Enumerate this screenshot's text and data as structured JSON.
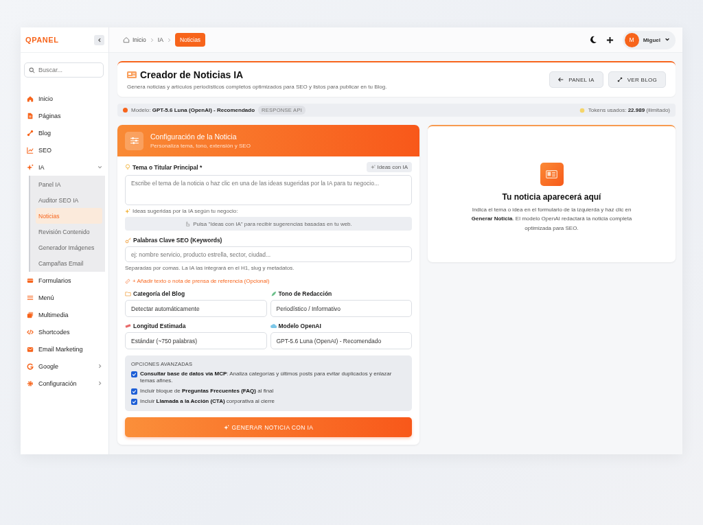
{
  "sidebar": {
    "logo": "QPANEL",
    "search": {
      "placeholder": "Buscar..."
    },
    "items": [
      {
        "label": "Inicio"
      },
      {
        "label": "Páginas"
      },
      {
        "label": "Blog"
      },
      {
        "label": "SEO"
      },
      {
        "label": "IA",
        "expanded": true,
        "children": [
          {
            "label": "Panel IA",
            "selected": false
          },
          {
            "label": "Auditor SEO IA",
            "selected": false
          },
          {
            "label": "Noticias",
            "selected": true
          },
          {
            "label": "Revisión Contenido",
            "selected": false
          },
          {
            "label": "Generador Imágenes",
            "selected": false
          },
          {
            "label": "Campañas Email",
            "selected": false
          }
        ]
      },
      {
        "label": "Formularios"
      },
      {
        "label": "Menú"
      },
      {
        "label": "Multimedia"
      },
      {
        "label": "Shortcodes"
      },
      {
        "label": "Email Marketing"
      },
      {
        "label": "Google",
        "expanded": false
      },
      {
        "label": "Configuración",
        "expanded": false
      }
    ]
  },
  "topbar": {
    "breadcrumb": [
      {
        "label": "Inicio",
        "current": false
      },
      {
        "label": "IA",
        "current": false
      },
      {
        "label": "Noticias",
        "current": true
      }
    ],
    "user": {
      "initial": "M",
      "name": "Miguel"
    }
  },
  "header": {
    "title": "Creador de Noticias IA",
    "subtitle": "Genera noticias y artículos periodísticos completos optimizados para SEO y listos para publicar en tu Blog.",
    "buttons": [
      "PANEL IA",
      "VER BLOG"
    ]
  },
  "model_bar": {
    "model": "Modelo: **GPT-5.6 Luna (OpenAI) - Recomendado**",
    "badge": "RESPONSE API",
    "tokens": "Tokens usados: **22.989** (ilimitado)"
  },
  "form": {
    "title": "Configuración de la Noticia",
    "subtitle": "Personaliza tema, tono, extensión y SEO",
    "topic": {
      "label": "Tema o Titular Principal *",
      "button": "Ideas con IA",
      "placeholder": "Escribe el tema de la noticia o haz clic en una de las ideas sugeridas por la IA para tu negocio..."
    },
    "ideas_hint": "Ideas sugeridas por la IA según tu negocio:",
    "ideas_box": "Pulsa \"Ideas con IA\" para recibir sugerencias basadas en tu web.",
    "keywords": {
      "label": "Palabras Clave SEO (Keywords)",
      "placeholder": "ej: nombre servicio, producto estrella, sector, ciudad...",
      "help": "Separadas por comas. La IA las integrará en el H1, slug y metadatos."
    },
    "add_reference": "+ Añadir texto o nota de prensa de referencia (Opcional)",
    "selects": [
      {
        "label": "Categoría del Blog",
        "value": "Detectar automáticamente"
      },
      {
        "label": "Tono de Redacción",
        "value": "Periodístico / Informativo"
      },
      {
        "label": "Longitud Estimada",
        "value": "Estándar (~750 palabras)"
      },
      {
        "label": "Modelo OpenAI",
        "value": "GPT-5.6 Luna (OpenAI) - Recomendado"
      }
    ],
    "advanced": {
      "title": "OPCIONES AVANZADAS",
      "options": [
        {
          "text": "**Consultar base de datos vía MCP**: Analiza categorías y últimos posts para evitar duplicados y enlazar temas afines.",
          "checked": true
        },
        {
          "text": "Incluir bloque de **Preguntas Frecuentes (FAQ)** al final",
          "checked": true
        },
        {
          "text": "Incluir **Llamada a la Acción (CTA)** corporativa al cierre",
          "checked": true
        }
      ]
    },
    "submit": "GENERAR NOTICIA CON IA"
  },
  "result": {
    "title": "Tu noticia aparecerá aquí",
    "text": "Indica el tema o idea en el formulario de la izquierda y haz clic en **Generar Noticia**. El modelo OpenAI redactará la noticia completa optimizada para SEO."
  }
}
